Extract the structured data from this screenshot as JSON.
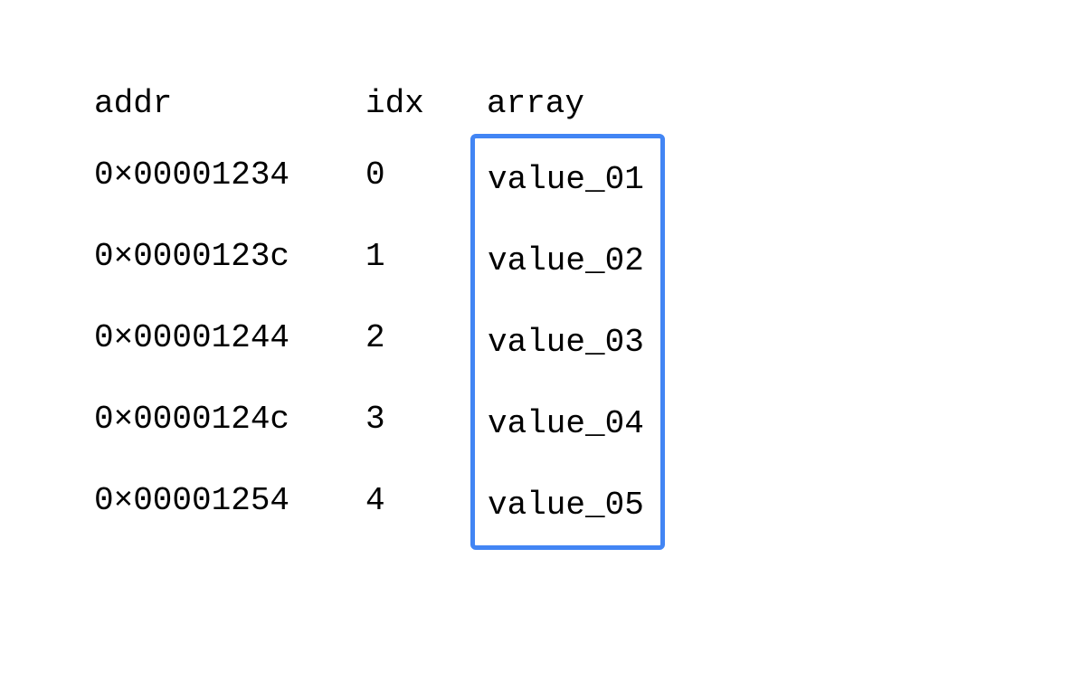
{
  "headers": {
    "addr": "addr",
    "idx": "idx",
    "array": "array"
  },
  "rows": [
    {
      "addr": "0×00001234",
      "idx": "0",
      "value": "value_01"
    },
    {
      "addr": "0×0000123c",
      "idx": "1",
      "value": "value_02"
    },
    {
      "addr": "0×00001244",
      "idx": "2",
      "value": "value_03"
    },
    {
      "addr": "0×0000124c",
      "idx": "3",
      "value": "value_04"
    },
    {
      "addr": "0×00001254",
      "idx": "4",
      "value": "value_05"
    }
  ],
  "colors": {
    "box_border": "#4285f4"
  }
}
